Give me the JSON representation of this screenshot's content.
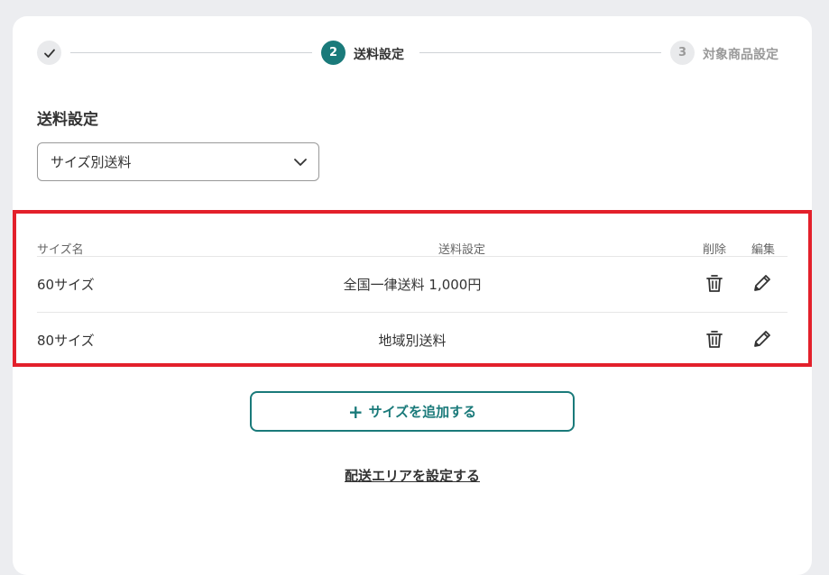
{
  "stepper": {
    "step2_number": "2",
    "step2_label": "送料設定",
    "step3_number": "3",
    "step3_label": "対象商品設定"
  },
  "section": {
    "title": "送料設定",
    "select_value": "サイズ別送料"
  },
  "table": {
    "headers": {
      "name": "サイズ名",
      "setting": "送料設定",
      "delete": "削除",
      "edit": "編集"
    },
    "rows": [
      {
        "name": "60サイズ",
        "setting": "全国一律送料 1,000円"
      },
      {
        "name": "80サイズ",
        "setting": "地域別送料"
      }
    ]
  },
  "actions": {
    "add_size": "サイズを追加する",
    "area_link": "配送エリアを設定する"
  },
  "colors": {
    "accent": "#1a7a7a",
    "highlight": "#e3202b"
  }
}
